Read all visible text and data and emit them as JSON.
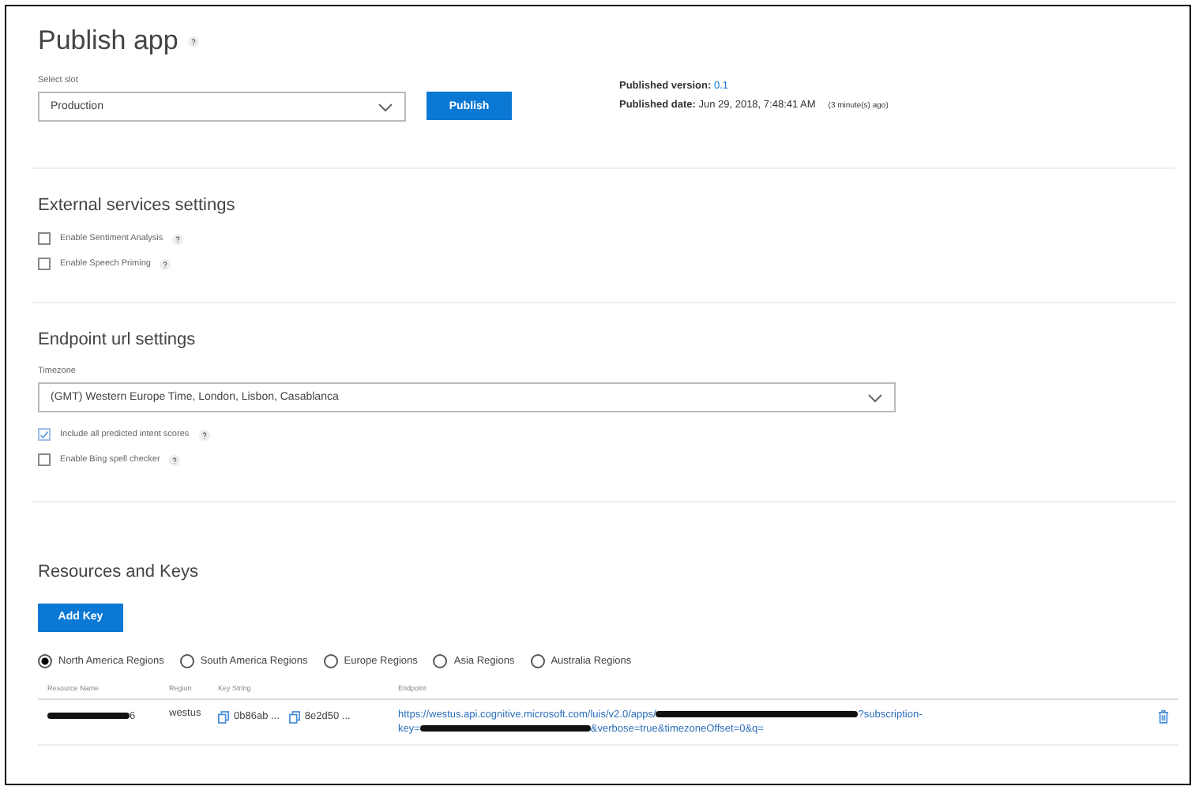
{
  "title": "Publish app",
  "slot": {
    "label": "Select slot",
    "value": "Production",
    "button": "Publish"
  },
  "published": {
    "version_label": "Published version:",
    "version": "0.1",
    "date_label": "Published date:",
    "date": "Jun 29, 2018, 7:48:41 AM",
    "ago": "(3 minute(s) ago)"
  },
  "external_services": {
    "heading": "External services settings",
    "options": [
      {
        "label": "Enable Sentiment Analysis",
        "checked": false
      },
      {
        "label": "Enable Speech Priming",
        "checked": false
      }
    ]
  },
  "endpoint_settings": {
    "heading": "Endpoint url settings",
    "timezone_label": "Timezone",
    "timezone": "(GMT) Western Europe Time, London, Lisbon, Casablanca",
    "options": [
      {
        "label": "Include all predicted intent scores",
        "checked": true
      },
      {
        "label": "Enable Bing spell checker",
        "checked": false
      }
    ]
  },
  "resources": {
    "heading": "Resources and Keys",
    "add_button": "Add Key",
    "regions": [
      {
        "label": "North America Regions",
        "selected": true
      },
      {
        "label": "South America Regions",
        "selected": false
      },
      {
        "label": "Europe Regions",
        "selected": false
      },
      {
        "label": "Asia Regions",
        "selected": false
      },
      {
        "label": "Australia Regions",
        "selected": false
      }
    ],
    "table": {
      "columns": [
        "Resource Name",
        "Region",
        "Key String",
        "Endpoint"
      ],
      "rows": [
        {
          "resource_name": [
            {
              "kind": "redacted"
            },
            {
              "kind": "text",
              "text": "6"
            }
          ],
          "region": "westus",
          "keys": [
            "0b86ab ...",
            "8e2d50 ..."
          ],
          "endpoint": [
            {
              "kind": "text",
              "text": "https://westus.api.cognitive.microsoft.com/luis/v2.0/apps/"
            },
            {
              "kind": "redacted"
            },
            {
              "kind": "text",
              "text": "?subscription-"
            },
            {
              "kind": "break"
            },
            {
              "kind": "text",
              "text": "key="
            },
            {
              "kind": "redacted"
            },
            {
              "kind": "text",
              "text": "&verbose=true&timezoneOffset=0&q="
            }
          ]
        }
      ]
    }
  }
}
